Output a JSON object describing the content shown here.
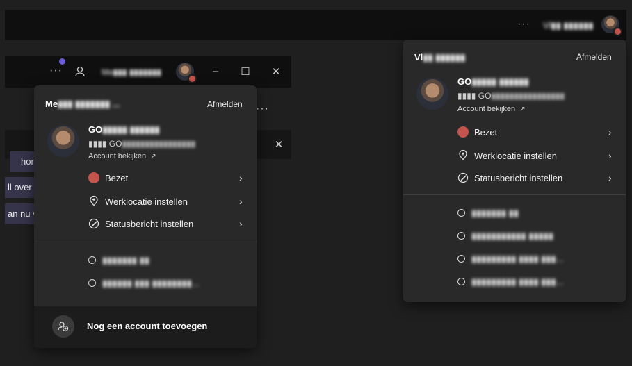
{
  "topbar": {
    "more_label": "···",
    "user_name": "Vl▮▮ ▮▮▮▮▮▮"
  },
  "inner_window": {
    "more_label": "···",
    "user_name": "Me▮▮▮ ▮▮▮▮▮▮▮",
    "minimize": "–",
    "maximize": "☐",
    "close": "✕",
    "close2": "✕",
    "more2": "···"
  },
  "chat": {
    "bubble1": "hor",
    "line2": "ll over v",
    "line3": "an nu v"
  },
  "left_panel": {
    "name": "Me",
    "name_blur": "▮▮▮ ▮▮▮▮▮▮▮ ...",
    "signout": "Afmelden",
    "account_name": "GO",
    "account_name_blur": "▮▮▮▮▮ ▮▮▮▮▮▮",
    "email_prefix": "▮▮▮▮ GO",
    "email_blur": "▮▮▮▮▮▮▮▮▮▮▮▮▮▮▮▮",
    "view_account": "Account bekijken",
    "status": "Bezet",
    "work_location": "Werklocatie instellen",
    "status_message": "Statusbericht instellen",
    "other_accounts": [
      "▮▮▮▮▮▮▮ ▮▮",
      "▮▮▮▮▮▮ ▮▮▮ ▮▮▮▮▮▮▮▮..."
    ],
    "add_account": "Nog een account toevoegen"
  },
  "right_panel": {
    "name": "Vl",
    "name_blur": "▮▮ ▮▮▮▮▮▮",
    "signout": "Afmelden",
    "account_name": "GO",
    "account_name_blur": "▮▮▮▮▮ ▮▮▮▮▮▮",
    "email_prefix": "▮▮▮▮ GO",
    "email_blur": "▮▮▮▮▮▮▮▮▮▮▮▮▮▮▮▮",
    "view_account": "Account bekijken",
    "status": "Bezet",
    "work_location": "Werklocatie instellen",
    "status_message": "Statusbericht instellen",
    "other_accounts": [
      "▮▮▮▮▮▮▮ ▮▮",
      "▮▮▮▮▮▮▮▮▮▮▮ ▮▮▮▮▮",
      "▮▮▮▮▮▮▮▮▮ ▮▮▮▮ ▮▮▮...",
      "▮▮▮▮▮▮▮▮▮ ▮▮▮▮ ▮▮▮..."
    ]
  },
  "colors": {
    "busy": "#c4544c",
    "panel": "#292929",
    "notification_dot": "#6b5bd6"
  }
}
